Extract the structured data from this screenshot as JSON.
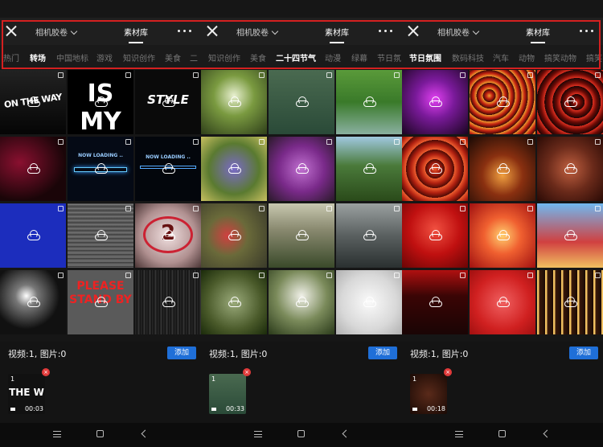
{
  "panels": [
    {
      "close_label": "×",
      "film_dropdown": "相机胶卷",
      "library_tab": "素材库",
      "categories": [
        {
          "label": "热门",
          "active": false
        },
        {
          "label": "转场",
          "active": true
        },
        {
          "label": "中国地标",
          "active": false
        },
        {
          "label": "游戏",
          "active": false
        },
        {
          "label": "知识创作",
          "active": false
        },
        {
          "label": "美食",
          "active": false
        },
        {
          "label": "二",
          "active": false
        }
      ],
      "tile_texts": [
        "ON THE WAY",
        "IS MY",
        "STYLE",
        "",
        "NOW LOADING ..",
        "NOW LOADING ..",
        "",
        "",
        "2",
        "",
        "PLEASE STAND BY",
        ""
      ],
      "count_text": "视频:1, 图片:0",
      "add_label": "添加",
      "selected": {
        "index": "1",
        "duration": "00:03",
        "thumb_text": "THE W"
      }
    },
    {
      "close_label": "×",
      "film_dropdown": "相机胶卷",
      "library_tab": "素材库",
      "categories": [
        {
          "label": "知识创作",
          "active": false
        },
        {
          "label": "美食",
          "active": false
        },
        {
          "label": "二十四节气",
          "active": true
        },
        {
          "label": "动漫",
          "active": false
        },
        {
          "label": "绿幕",
          "active": false
        },
        {
          "label": "节日氛",
          "active": false
        }
      ],
      "tile_texts": [
        "",
        "",
        "",
        "",
        "",
        "",
        "",
        "",
        "",
        "",
        "",
        ""
      ],
      "count_text": "视频:1, 图片:0",
      "add_label": "添加",
      "selected": {
        "index": "1",
        "duration": "00:33",
        "thumb_text": ""
      }
    },
    {
      "close_label": "×",
      "film_dropdown": "相机胶卷",
      "library_tab": "素材库",
      "categories": [
        {
          "label": "节日氛围",
          "active": true
        },
        {
          "label": "数码科技",
          "active": false
        },
        {
          "label": "汽车",
          "active": false
        },
        {
          "label": "动物",
          "active": false
        },
        {
          "label": "搞笑动物",
          "active": false
        },
        {
          "label": "搞笑",
          "active": false
        }
      ],
      "tile_texts": [
        "",
        "",
        "",
        "",
        "",
        "",
        "",
        "",
        "",
        "",
        "",
        ""
      ],
      "count_text": "视频:1, 图片:0",
      "add_label": "添加",
      "selected": {
        "index": "1",
        "duration": "00:18",
        "thumb_text": ""
      }
    }
  ],
  "colors": {
    "accent_blue": "#1f6fd8",
    "remove_red": "#e23b3b",
    "highlight_red": "#d42020"
  }
}
